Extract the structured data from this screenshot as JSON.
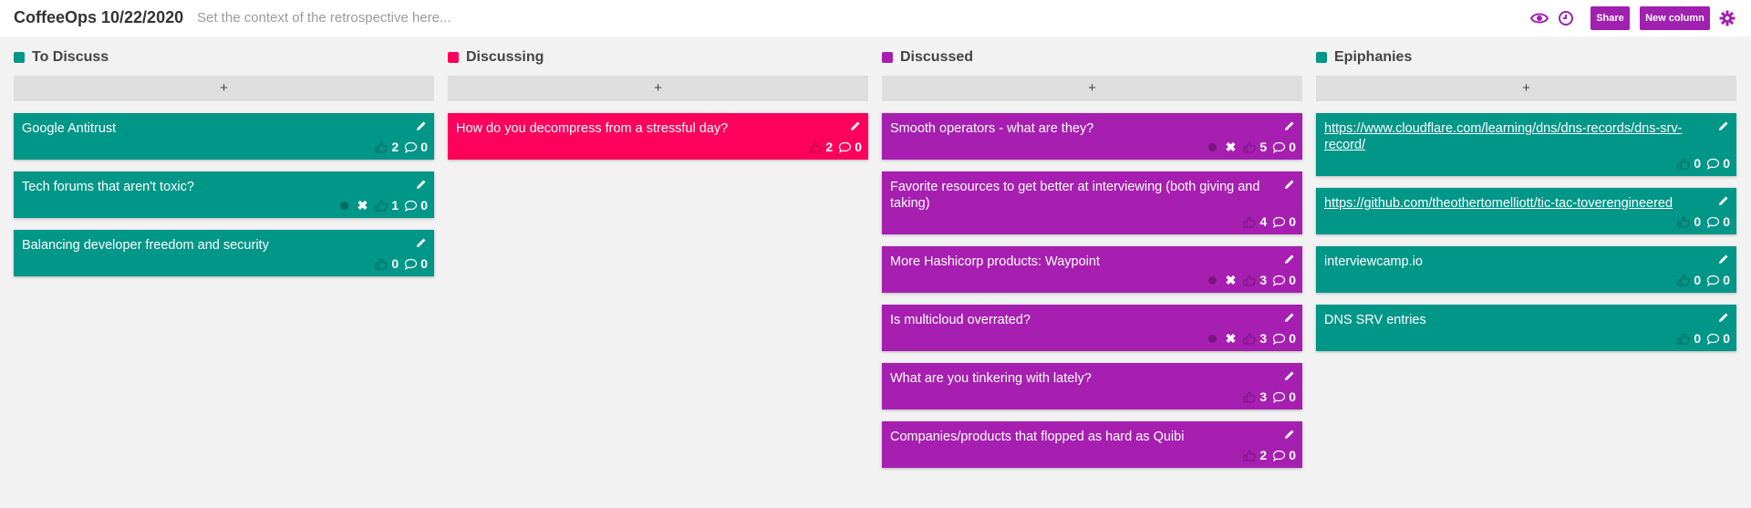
{
  "board": {
    "title": "CoffeeOps 10/22/2020",
    "context_placeholder": "Set the context of the retrospective here...",
    "share_label": "Share",
    "new_column_label": "New column"
  },
  "colors": {
    "teal": "#009688",
    "pink": "#ff005a",
    "purple": "#a61fb0",
    "accent": "#a020b0"
  },
  "columns": [
    {
      "title": "To Discuss",
      "color": "#009688",
      "add_label": "+",
      "cards": [
        {
          "text": "Google Antitrust",
          "votes": "2",
          "comments": "0",
          "voted": false
        },
        {
          "text": "Tech forums that aren't toxic?",
          "votes": "1",
          "comments": "0",
          "voted": true
        },
        {
          "text": "Balancing developer freedom and security",
          "votes": "0",
          "comments": "0",
          "voted": false
        }
      ]
    },
    {
      "title": "Discussing",
      "color": "#ff005a",
      "add_label": "+",
      "cards": [
        {
          "text": "How do you decompress from a stressful day?",
          "votes": "2",
          "comments": "0",
          "voted": false
        }
      ]
    },
    {
      "title": "Discussed",
      "color": "#a61fb0",
      "add_label": "+",
      "cards": [
        {
          "text": "Smooth operators - what are they?",
          "votes": "5",
          "comments": "0",
          "voted": true
        },
        {
          "text": "Favorite resources to get better at interviewing (both giving and taking)",
          "votes": "4",
          "comments": "0",
          "voted": false
        },
        {
          "text": "More Hashicorp products: Waypoint",
          "votes": "3",
          "comments": "0",
          "voted": true
        },
        {
          "text": "Is multicloud overrated?",
          "votes": "3",
          "comments": "0",
          "voted": true
        },
        {
          "text": "What are you tinkering with lately?",
          "votes": "3",
          "comments": "0",
          "voted": false
        },
        {
          "text": "Companies/products that flopped as hard as Quibi",
          "votes": "2",
          "comments": "0",
          "voted": false
        }
      ]
    },
    {
      "title": "Epiphanies",
      "color": "#009688",
      "add_label": "+",
      "cards": [
        {
          "text": "https://www.cloudflare.com/learning/dns/dns-records/dns-srv-record/",
          "votes": "0",
          "comments": "0",
          "voted": false,
          "link": true
        },
        {
          "text": "https://github.com/theothertomelliott/tic-tac-toverengineered",
          "votes": "0",
          "comments": "0",
          "voted": false,
          "link": true
        },
        {
          "text": "interviewcamp.io",
          "votes": "0",
          "comments": "0",
          "voted": false
        },
        {
          "text": "DNS SRV entries",
          "votes": "0",
          "comments": "0",
          "voted": false
        }
      ]
    }
  ]
}
